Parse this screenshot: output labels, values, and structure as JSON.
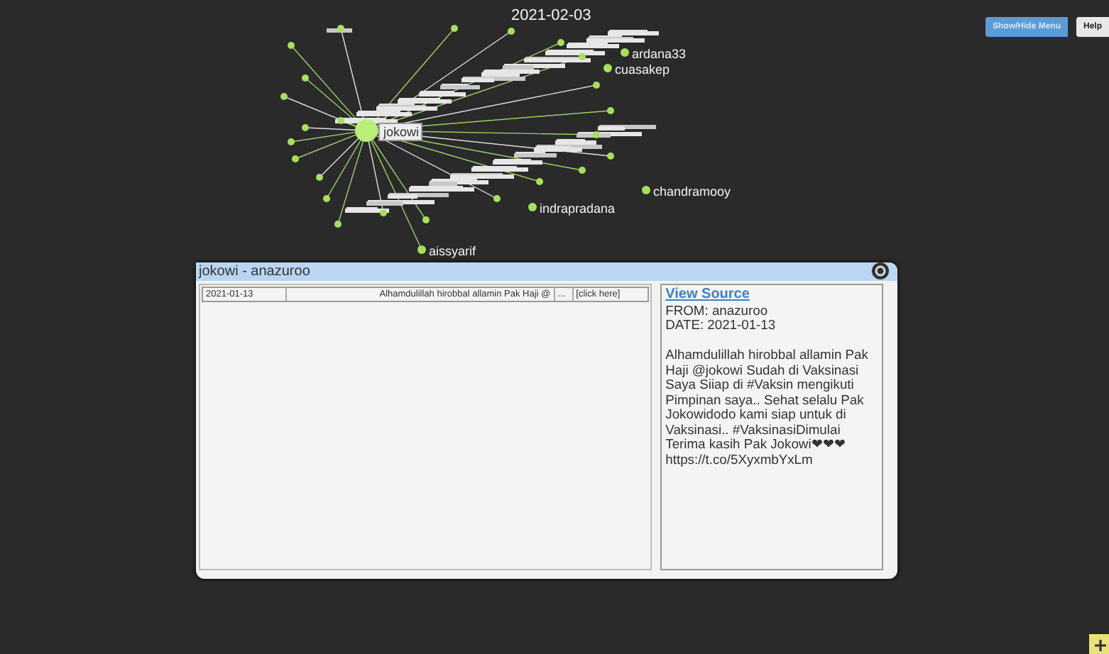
{
  "toolbar": {
    "buttons": [
      {
        "label": "Show/Hide Menu",
        "selected": true
      },
      {
        "label": "Help",
        "selected": false
      }
    ]
  },
  "graph": {
    "date_label": "2021-02-03",
    "nodes": [
      {
        "label": "jokowi",
        "kind": "hub",
        "highlighted": true
      },
      {
        "label": "ardana33",
        "kind": "leaf",
        "highlighted": false
      },
      {
        "label": "cuasakep",
        "kind": "leaf",
        "highlighted": false
      },
      {
        "label": "chandramooy",
        "kind": "leaf",
        "highlighted": false
      },
      {
        "label": "indrapradana",
        "kind": "leaf",
        "highlighted": false
      },
      {
        "label": "aissyarif",
        "kind": "leaf",
        "highlighted": false
      }
    ]
  },
  "dialog": {
    "title": "jokowi - anazuroo",
    "rows": [
      {
        "date": "2021-01-13",
        "text": "Alhamdulillah hirobbal allamin Pak Haji @",
        "more": "...",
        "link": "[click here]",
        "selected": false
      }
    ],
    "detail": {
      "link": "View Source",
      "from": "FROM: anazuroo",
      "date": "DATE: 2021-01-13",
      "message": "Alhamdulillah hirobbal allamin Pak Haji @jokowi Sudah di Vaksinasi Saya Siiap di #Vaksin mengikuti Pimpinan saya.. Sehat selalu Pak Jokowidodo kami siap untuk di Vaksinasi.. #VaksinasiDimulai Terima kasih Pak Jokowi❤❤❤ https://t.co/5XyxmbYxLm"
    }
  }
}
